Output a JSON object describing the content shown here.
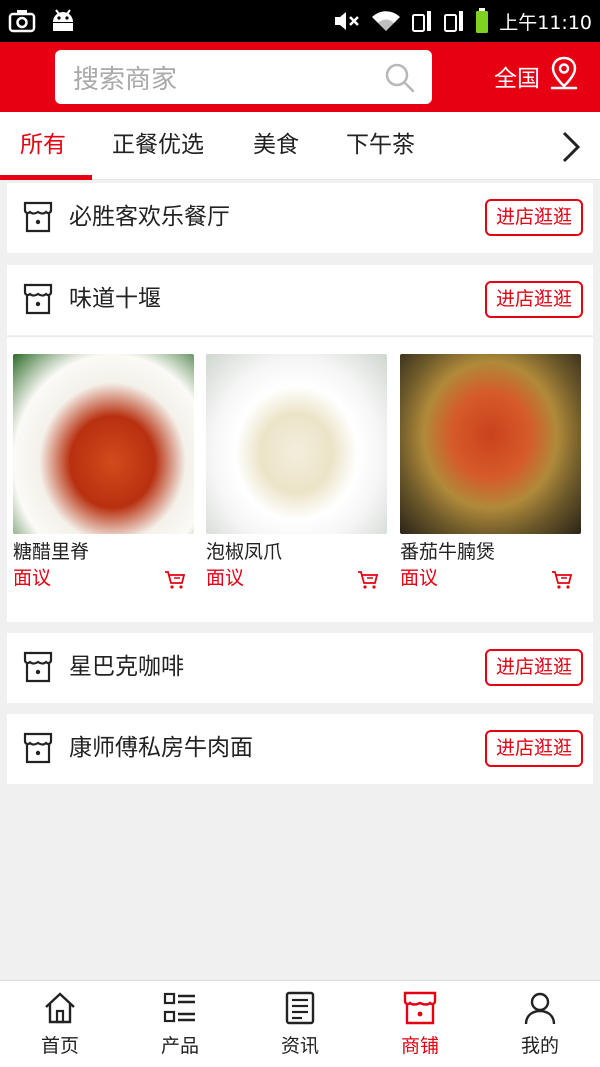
{
  "status_bar": {
    "time": "上午11:10"
  },
  "header": {
    "search_placeholder": "搜索商家",
    "region_label": "全国"
  },
  "tabs": [
    {
      "label": "所有"
    },
    {
      "label": "正餐优选"
    },
    {
      "label": "美食"
    },
    {
      "label": "下午茶"
    }
  ],
  "stores": [
    {
      "name": "必胜客欢乐餐厅",
      "button": "进店逛逛"
    },
    {
      "name": "味道十堰",
      "button": "进店逛逛"
    },
    {
      "name": "星巴克咖啡",
      "button": "进店逛逛"
    },
    {
      "name": "康师傅私房牛肉面",
      "button": "进店逛逛"
    }
  ],
  "products": [
    {
      "name": "糖醋里脊",
      "price": "面议"
    },
    {
      "name": "泡椒凤爪",
      "price": "面议"
    },
    {
      "name": "番茄牛腩煲",
      "price": "面议"
    }
  ],
  "bottom_nav": [
    {
      "label": "首页",
      "icon": "home-icon"
    },
    {
      "label": "产品",
      "icon": "list-icon"
    },
    {
      "label": "资讯",
      "icon": "news-icon"
    },
    {
      "label": "商铺",
      "icon": "store-icon"
    },
    {
      "label": "我的",
      "icon": "user-icon"
    }
  ],
  "colors": {
    "brand_red": "#e60012",
    "background": "#f0f0f0"
  }
}
